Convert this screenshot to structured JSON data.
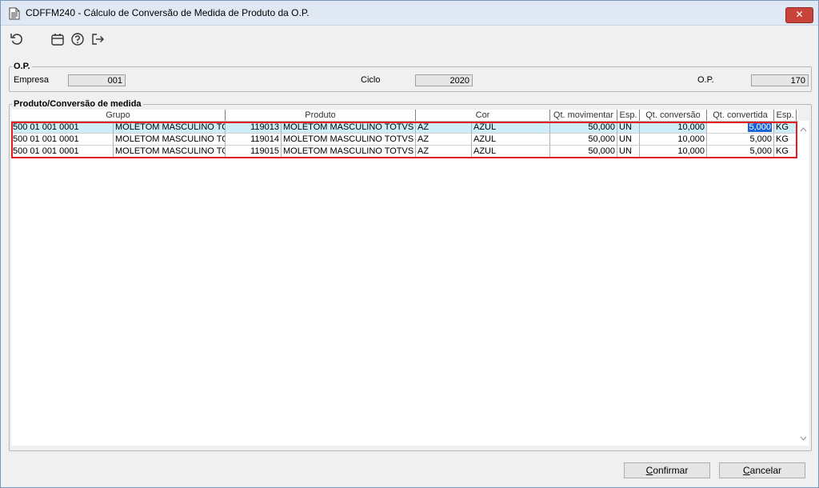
{
  "window": {
    "title": "CDFFM240 - Cálculo de Conversão de Medida de Produto da O.P.",
    "close_label": "✕"
  },
  "toolbar": {
    "icons": [
      "refresh-icon",
      "calendar-icon",
      "help-icon",
      "exit-icon"
    ]
  },
  "op_group": {
    "label": "O.P.",
    "empresa_label": "Empresa",
    "empresa_value": "001",
    "ciclo_label": "Ciclo",
    "ciclo_value": "2020",
    "op_label": "O.P.",
    "op_value": "170"
  },
  "grid_group": {
    "label": "Produto/Conversão de medida",
    "headers": {
      "grupo": "Grupo",
      "produto": "Produto",
      "cor": "Cor",
      "qt_mov": "Qt. movimentar",
      "esp1": "Esp.",
      "qt_conv": "Qt. conversão",
      "qt_convertida": "Qt. convertida",
      "esp2": "Esp."
    },
    "rows": [
      {
        "grupo_cod": "500 01 001 0001",
        "grupo_desc": "MOLETOM MASCULINO TOT",
        "prod_cod": "119013",
        "prod_desc": "MOLETOM MASCULINO TOTVS MO",
        "cor_cod": "AZ",
        "cor_desc": "AZUL",
        "qt_mov": "50,000",
        "esp1": "UN",
        "qt_conv": "10,000",
        "qt_convertida": "5,000",
        "esp2": "KG"
      },
      {
        "grupo_cod": "500 01 001 0001",
        "grupo_desc": "MOLETOM MASCULINO TOT",
        "prod_cod": "119014",
        "prod_desc": "MOLETOM MASCULINO TOTVS MO",
        "cor_cod": "AZ",
        "cor_desc": "AZUL",
        "qt_mov": "50,000",
        "esp1": "UN",
        "qt_conv": "10,000",
        "qt_convertida": "5,000",
        "esp2": "KG"
      },
      {
        "grupo_cod": "500 01 001 0001",
        "grupo_desc": "MOLETOM MASCULINO TOT",
        "prod_cod": "119015",
        "prod_desc": "MOLETOM MASCULINO TOTVS MO",
        "cor_cod": "AZ",
        "cor_desc": "AZUL",
        "qt_mov": "50,000",
        "esp1": "UN",
        "qt_conv": "10,000",
        "qt_convertida": "5,000",
        "esp2": "KG"
      }
    ]
  },
  "buttons": {
    "confirm_underlined": "C",
    "confirm_rest": "onfirmar",
    "cancel_underlined": "C",
    "cancel_rest": "ancelar"
  },
  "colors": {
    "selected_row": "#cdeef8",
    "edit_highlight": "#1a66d6",
    "annotation_box": "#e02020"
  }
}
